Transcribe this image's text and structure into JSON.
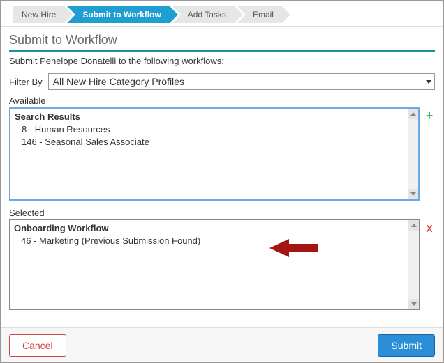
{
  "breadcrumb": [
    {
      "label": "New Hire",
      "active": false
    },
    {
      "label": "Submit to Workflow",
      "active": true
    },
    {
      "label": "Add Tasks",
      "active": false
    },
    {
      "label": "Email",
      "active": false
    }
  ],
  "page_title": "Submit to Workflow",
  "subtitle": "Submit Penelope Donatelli to the following workflows:",
  "filter": {
    "label": "Filter By",
    "selected": "All New Hire Category Profiles"
  },
  "available": {
    "label": "Available",
    "header": "Search Results",
    "items": [
      "8 - Human Resources",
      "146 - Seasonal Sales Associate"
    ]
  },
  "selected": {
    "label": "Selected",
    "header": "Onboarding Workflow",
    "items": [
      "46 - Marketing (Previous Submission Found)"
    ]
  },
  "buttons": {
    "cancel": "Cancel",
    "submit": "Submit"
  },
  "icons": {
    "add": "+",
    "remove": "x"
  }
}
